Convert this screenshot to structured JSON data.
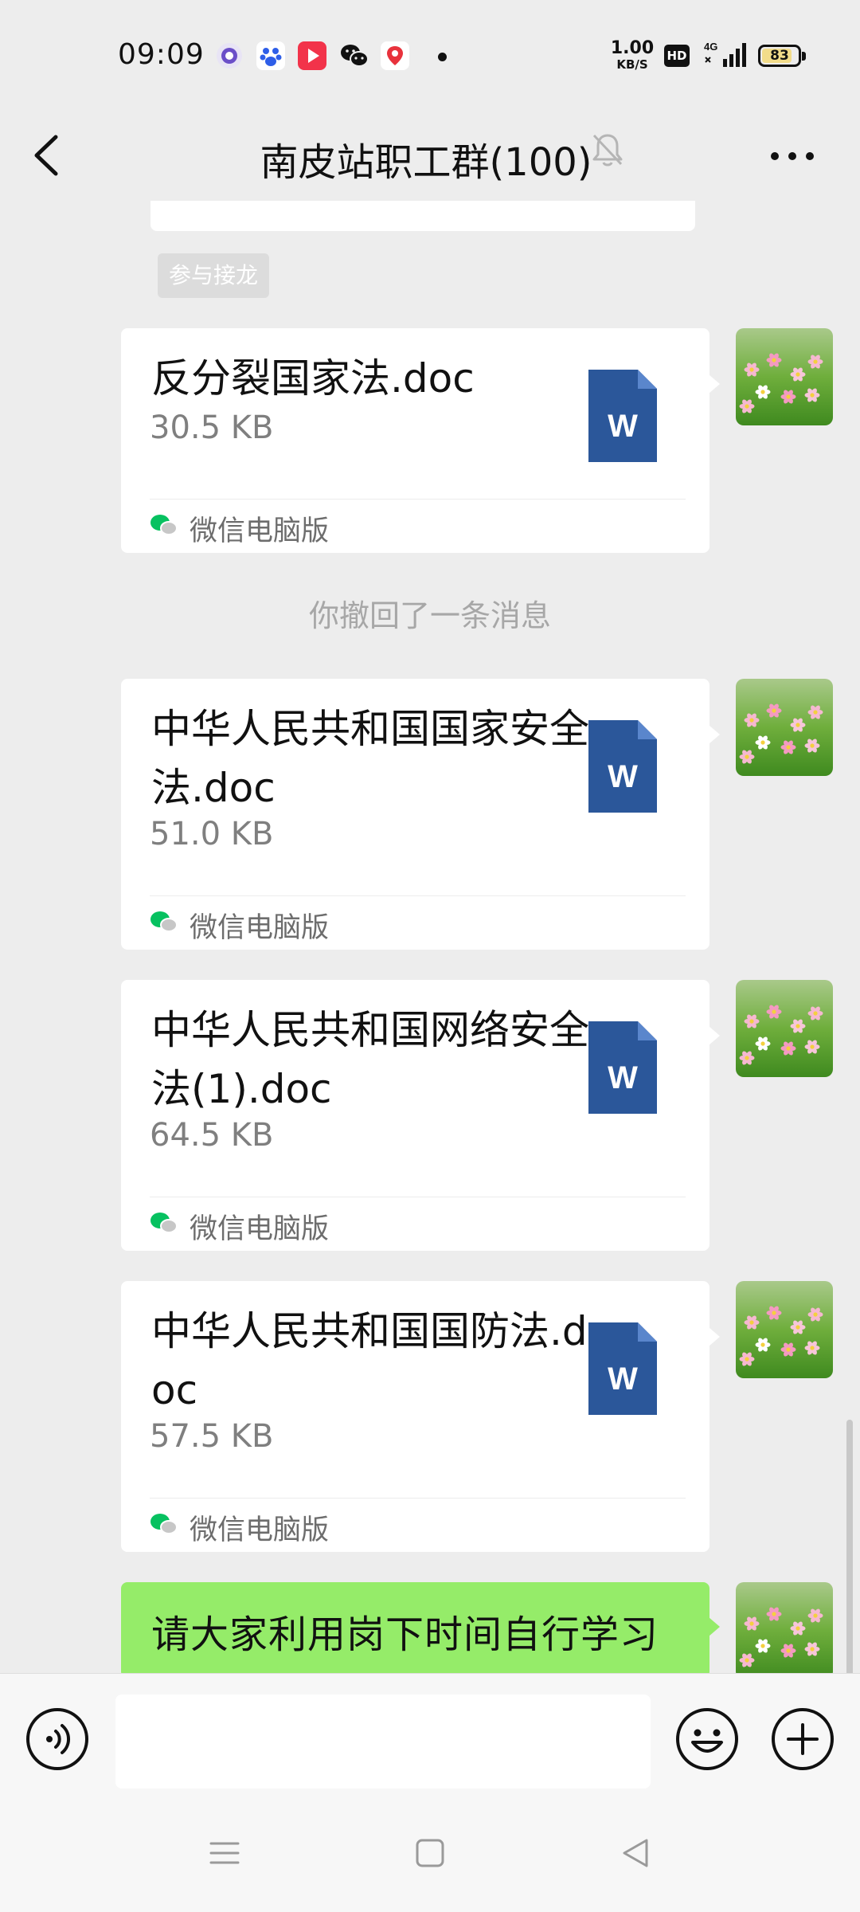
{
  "status_bar": {
    "time": "09:09",
    "net_speed_value": "1.00",
    "net_speed_unit": "KB/S",
    "hd_badge": "HD",
    "network_type": "4G",
    "battery_level": "83",
    "battery_fraction": 0.83,
    "app_icons": [
      "purple-app-icon",
      "baidu-icon",
      "video-app-icon",
      "wechat-icon",
      "map-pin-icon"
    ]
  },
  "nav": {
    "title": "南皮站职工群(100)",
    "muted": true
  },
  "chat": {
    "join_tag": "参与接龙",
    "recall_notice": "你撤回了一条消息",
    "file_messages": [
      {
        "name": "反分裂国家法.doc",
        "size": "30.5 KB",
        "source": "微信电脑版"
      },
      {
        "name": "中华人民共和国国家安全法.doc",
        "size": "51.0 KB",
        "source": "微信电脑版"
      },
      {
        "name": "中华人民共和国网络安全法(1).doc",
        "size": "64.5 KB",
        "source": "微信电脑版"
      },
      {
        "name": "中华人民共和国国防法.doc",
        "size": "57.5 KB",
        "source": "微信电脑版"
      }
    ],
    "word_icon_letter": "W",
    "text_message": "请大家利用岗下时间自行学习"
  },
  "input_bar": {
    "text": "",
    "placeholder": ""
  },
  "colors": {
    "background": "#ededed",
    "my_bubble": "#95ec69",
    "word_blue": "#2b579a",
    "wechat_green": "#07c160"
  }
}
